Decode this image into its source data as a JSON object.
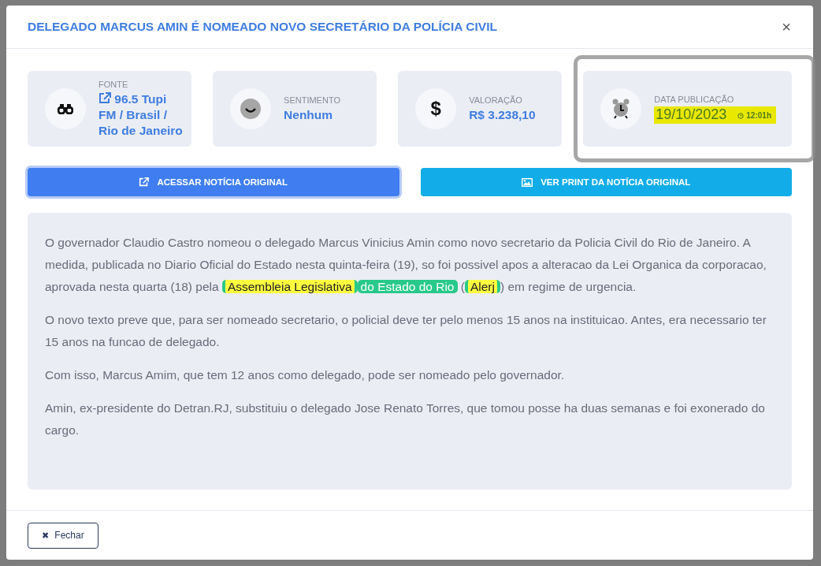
{
  "modal": {
    "title": "DELEGADO MARCUS AMIN É NOMEADO NOVO SECRETÁRIO DA POLÍCIA CIVIL",
    "close": "×"
  },
  "cards": [
    {
      "kind": "source",
      "label": "FONTE",
      "value": "96.5 Tupi FM / Brasil / Rio de Janeiro",
      "highlighted": false
    },
    {
      "kind": "sentiment",
      "label": "SENTIMENTO",
      "value": "Nenhum",
      "highlighted": false
    },
    {
      "kind": "value",
      "icon_text": "$",
      "label": "VALORAÇÃO",
      "value": "R$ 3.238,10",
      "highlighted": false
    },
    {
      "kind": "date",
      "label": "DATA PUBLICAÇÃO",
      "value": "19/10/2023",
      "time": "12:01h",
      "highlighted": true
    }
  ],
  "buttons": [
    {
      "kind": "link",
      "label": "ACESSAR NOTÍCIA ORIGINAL",
      "selected": true
    },
    {
      "kind": "image",
      "label": "VER PRINT DA NOTÍCIA ORIGINAL",
      "selected": false
    }
  ],
  "article": [
    [
      {
        "text": "O governador Claudio Castro nomeou o delegado Marcus Vinicius Amin como novo secretario da Policia Civil do Rio de Janeiro. A medida, publicada no Diario Oficial do Estado nesta quinta-feira (19), so foi possivel apos a alteracao da Lei Organica da corporacao, aprovada nesta quarta (18) pela ",
        "kind": "plain"
      },
      {
        "text": "Assembleia Legislativa",
        "kind": "marked"
      },
      {
        "text": "do Estado do Rio",
        "kind": "tag"
      },
      {
        "text": " (",
        "kind": "plain"
      },
      {
        "text": "Alerj",
        "kind": "marked"
      },
      {
        "text": ") em regime de urgencia.",
        "kind": "plain"
      }
    ],
    [
      {
        "text": "O novo texto preve que, para ser nomeado secretario, o policial deve ter pelo menos 15 anos na instituicao. Antes, era necessario ter 15 anos na funcao de delegado.",
        "kind": "plain"
      }
    ],
    [
      {
        "text": "Com isso, Marcus Amim, que tem 12 anos como delegado, pode ser nomeado pelo governador.",
        "kind": "plain"
      }
    ],
    [
      {
        "text": "Amin, ex-presidente do Detran.RJ, substituiu o delegado Jose Renato Torres, que tomou posse ha duas semanas e foi exonerado do cargo.",
        "kind": "plain"
      }
    ]
  ],
  "footer": {
    "close_icon": "✖",
    "close_label": "Fechar"
  }
}
